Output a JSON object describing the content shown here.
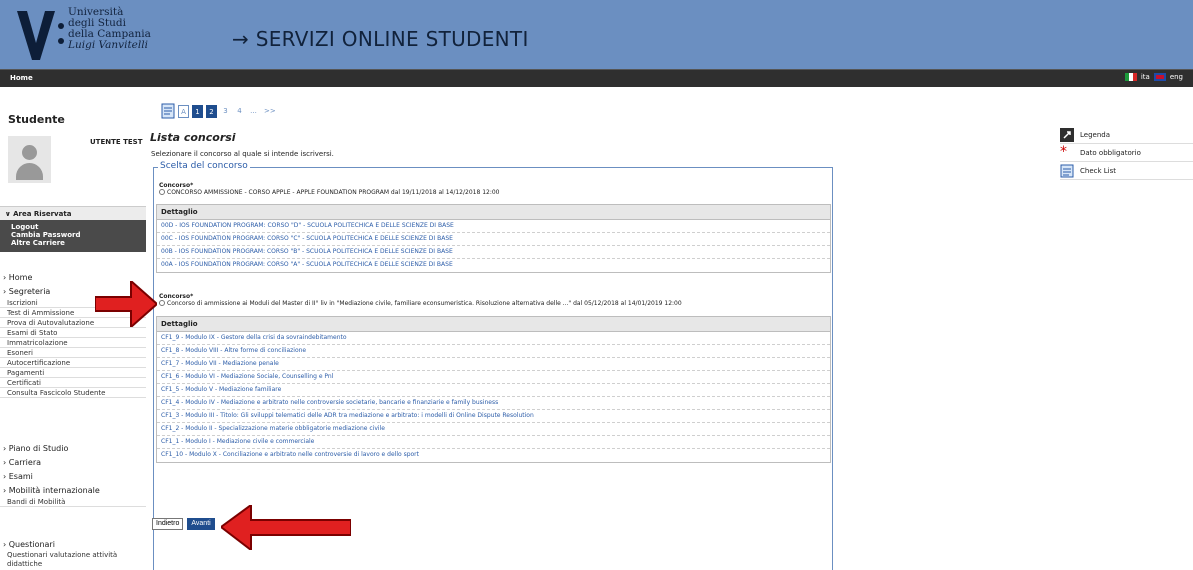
{
  "header": {
    "logo_lines": [
      "Università",
      "degli Studi",
      "della Campania",
      "Luigi Vanvitelli"
    ],
    "title": "→ SERVIZI ONLINE STUDENTI"
  },
  "topbar": {
    "home": "Home",
    "lang_ita": "ita",
    "lang_eng": "eng"
  },
  "sidebar": {
    "section_title": "Studente",
    "user": "UTENTE TEST",
    "area_riservata": "Area Riservata",
    "dark_items": [
      "Logout",
      "Cambia Password",
      "Altre Carriere"
    ],
    "nav": [
      {
        "label": "Home"
      },
      {
        "label": "Segreteria"
      }
    ],
    "segreteria_items": [
      "Iscrizioni",
      "Test di Ammissione",
      "Prova di Autovalutazione",
      "Esami di Stato",
      "Immatricolazione",
      "Esoneri",
      "Autocertificazione",
      "Pagamenti",
      "Certificati",
      "Consulta Fascicolo Studente"
    ],
    "bottom_nav": [
      "Piano di Studio",
      "Carriera",
      "Esami",
      "Mobilità internazionale"
    ],
    "mobilita_items": [
      "Bandi di Mobilità"
    ],
    "questionari": "Questionari",
    "questionari_items": [
      "Questionari valutazione attività didattiche"
    ]
  },
  "main": {
    "pager": [
      "A",
      "1",
      "2",
      "3",
      "4",
      "...",
      ">>"
    ],
    "title": "Lista concorsi",
    "description": "Selezionare il concorso al quale si intende iscriversi.",
    "fieldset_legend": "Scelta del concorso",
    "concorso_label": "Concorso*",
    "concorso1": "CONCORSO AMMISSIONE - CORSO APPLE - APPLE FOUNDATION PROGRAM dal 19/11/2018 al 14/12/2018 12:00",
    "concorso2": "Concorso di ammissione ai Moduli del Master di II° liv in \"Mediazione civile, familiare econsumeristica. Risoluzione alternativa delle ...\" dal 05/12/2018 al 14/01/2019 12:00",
    "dettaglio": "Dettaglio",
    "rows1": [
      "00D - IOS FOUNDATION PROGRAM: CORSO \"D\" - SCUOLA POLITECHICA E DELLE SCIENZE DI BASE",
      "00C - IOS FOUNDATION PROGRAM: CORSO \"C\" - SCUOLA POLITECHICA E DELLE SCIENZE DI BASE",
      "00B - IOS FOUNDATION PROGRAM: CORSO \"B\" - SCUOLA POLITECHICA E DELLE SCIENZE DI BASE",
      "00A - IOS FOUNDATION PROGRAM: CORSO \"A\" - SCUOLA POLITECHICA E DELLE SCIENZE DI BASE"
    ],
    "rows2": [
      "CF1_9 - Modulo IX - Gestore della crisi da sovraindebitamento",
      "CF1_8 - Modulo VIII - Altre forme di conciliazione",
      "CF1_7 - Modulo VII - Mediazione penale",
      "CF1_6 - Modulo VI - Mediazione Sociale, Counselling e Pnl",
      "CF1_5 - Modulo V - Mediazione familiare",
      "CF1_4 - Modulo IV - Mediazione e arbitrato nelle controversie societarie, bancarie e finanziarie e family business",
      "CF1_3 - Modulo III - Titolo: Gli sviluppi telematici delle ADR tra mediazione e arbitrato: i modelli di Online Dispute Resolution",
      "CF1_2 - Modulo II - Specializzazione materie obbligatorie mediazione civile",
      "CF1_1 - Modulo I - Mediazione civile e commerciale",
      "CF1_10 - Modulo X - Conciliazione e arbitrato nelle controversie di lavoro e dello sport"
    ],
    "back_button": "Indietro",
    "next_button": "Avanti"
  },
  "right_panel": {
    "legenda": "Legenda",
    "required": "Dato obbligatorio",
    "checklist": "Check List"
  }
}
